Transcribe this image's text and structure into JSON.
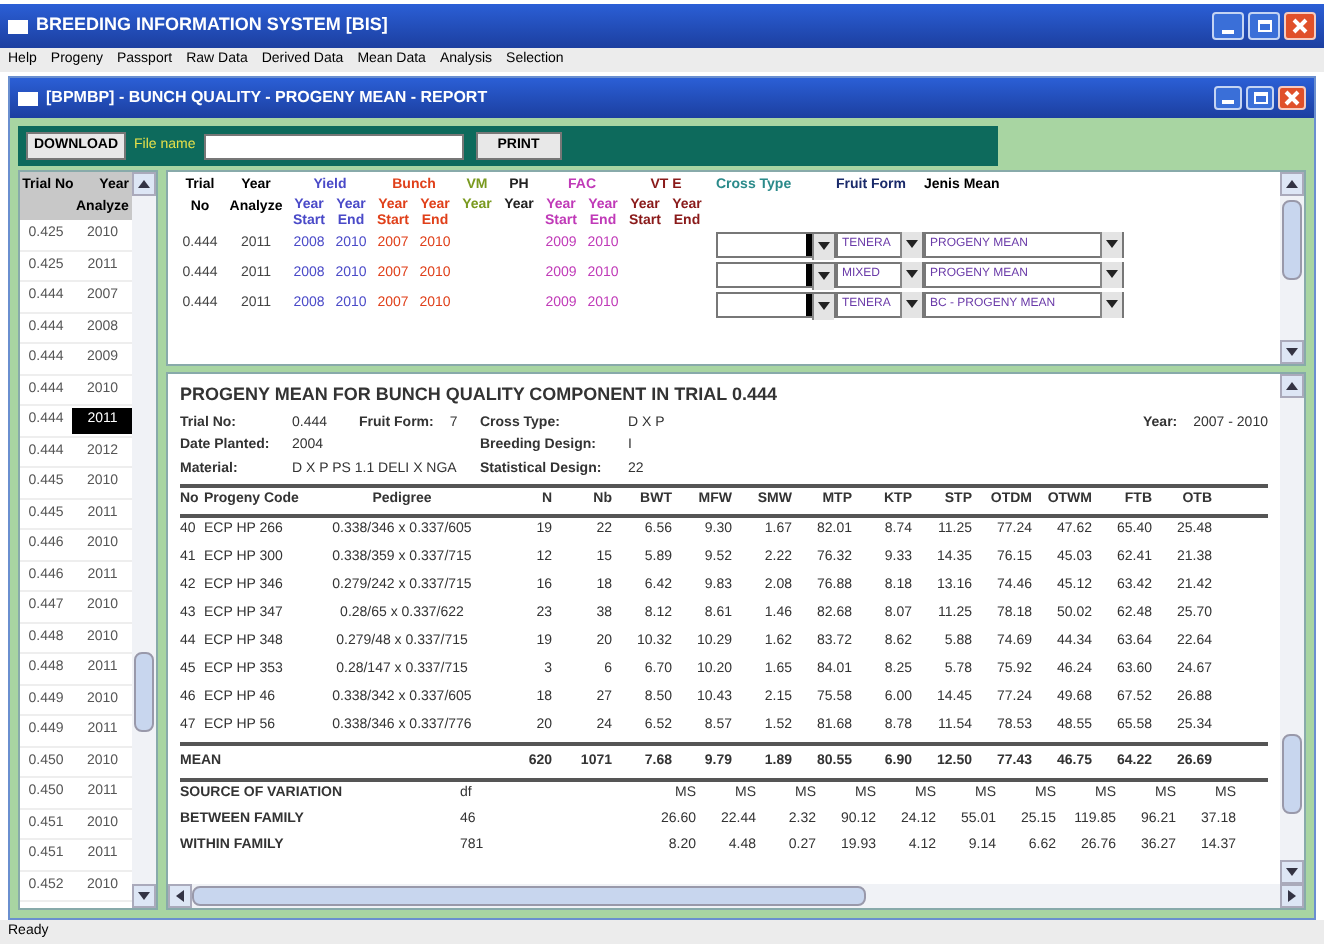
{
  "window": {
    "title": "BREEDING INFORMATION SYSTEM [BIS]"
  },
  "menu": [
    "Help",
    "Progeny",
    "Passport",
    "Raw Data",
    "Derived Data",
    "Mean Data",
    "Analysis",
    "Selection"
  ],
  "child_window": {
    "title": "[BPMBP] - BUNCH QUALITY - PROGENY MEAN - REPORT"
  },
  "toolbar": {
    "download": "DOWNLOAD",
    "file_name_label": "File name",
    "print": "PRINT"
  },
  "trial_list": {
    "columns": [
      "Trial No",
      "Year Analyze"
    ],
    "rows": [
      {
        "trial": "0.425",
        "year": "2010",
        "selected": false
      },
      {
        "trial": "0.425",
        "year": "2011",
        "selected": false
      },
      {
        "trial": "0.444",
        "year": "2007",
        "selected": false
      },
      {
        "trial": "0.444",
        "year": "2008",
        "selected": false
      },
      {
        "trial": "0.444",
        "year": "2009",
        "selected": false
      },
      {
        "trial": "0.444",
        "year": "2010",
        "selected": false
      },
      {
        "trial": "0.444",
        "year": "2011",
        "selected": true
      },
      {
        "trial": "0.444",
        "year": "2012",
        "selected": false
      },
      {
        "trial": "0.445",
        "year": "2010",
        "selected": false
      },
      {
        "trial": "0.445",
        "year": "2011",
        "selected": false
      },
      {
        "trial": "0.446",
        "year": "2010",
        "selected": false
      },
      {
        "trial": "0.446",
        "year": "2011",
        "selected": false
      },
      {
        "trial": "0.447",
        "year": "2010",
        "selected": false
      },
      {
        "trial": "0.448",
        "year": "2010",
        "selected": false
      },
      {
        "trial": "0.448",
        "year": "2011",
        "selected": false
      },
      {
        "trial": "0.449",
        "year": "2010",
        "selected": false
      },
      {
        "trial": "0.449",
        "year": "2011",
        "selected": false
      },
      {
        "trial": "0.450",
        "year": "2010",
        "selected": false
      },
      {
        "trial": "0.450",
        "year": "2011",
        "selected": false
      },
      {
        "trial": "0.451",
        "year": "2010",
        "selected": false
      },
      {
        "trial": "0.451",
        "year": "2011",
        "selected": false
      },
      {
        "trial": "0.452",
        "year": "2010",
        "selected": false
      }
    ]
  },
  "selection_grid": {
    "trial_no": "Trial No",
    "year_analyze": "Year Analyze",
    "groups": [
      {
        "label": "Yield",
        "color": "#4a4ac8",
        "subs": [
          "Year Start",
          "Year End"
        ]
      },
      {
        "label": "Bunch",
        "color": "#e0401a",
        "subs": [
          "Year Start",
          "Year End"
        ]
      },
      {
        "label": "VM",
        "color": "#7a9a20",
        "subs": [
          "Year"
        ]
      },
      {
        "label": "PH",
        "color": "#222222",
        "subs": [
          "Year"
        ]
      },
      {
        "label": "FAC",
        "color": "#c03ab8",
        "subs": [
          "Year Start",
          "Year End"
        ]
      },
      {
        "label": "VT E",
        "color": "#8a1a1a",
        "subs": [
          "Year Start",
          "Year End"
        ]
      }
    ],
    "cross_type": "Cross Type",
    "fruit_form": "Fruit Form",
    "jenis_mean": "Jenis Mean",
    "rows": [
      {
        "trial_no": "0.444",
        "year_analyze": "2011",
        "yield_years": [
          "2008",
          "2010"
        ],
        "bunch_years": [
          "2007",
          "2010"
        ],
        "fac_years": [
          "2009",
          "2010"
        ],
        "fruit_form": "TENERA",
        "jenis_mean": "PROGENY MEAN"
      },
      {
        "trial_no": "0.444",
        "year_analyze": "2011",
        "yield_years": [
          "2008",
          "2010"
        ],
        "bunch_years": [
          "2007",
          "2010"
        ],
        "fac_years": [
          "2009",
          "2010"
        ],
        "fruit_form": "MIXED",
        "jenis_mean": "PROGENY MEAN"
      },
      {
        "trial_no": "0.444",
        "year_analyze": "2011",
        "yield_years": [
          "2008",
          "2010"
        ],
        "bunch_years": [
          "2007",
          "2010"
        ],
        "fac_years": [
          "2009",
          "2010"
        ],
        "fruit_form": "TENERA",
        "jenis_mean": "BC - PROGENY MEAN"
      }
    ]
  },
  "report": {
    "title": "PROGENY MEAN FOR BUNCH QUALITY COMPONENT IN TRIAL  0.444",
    "info": {
      "trial_no": {
        "label": "Trial No:",
        "value": "0.444"
      },
      "fruit_form": {
        "label": "Fruit Form:",
        "value": "7"
      },
      "cross_type": {
        "label": "Cross Type:",
        "value": "D X P"
      },
      "year": {
        "label": "Year:",
        "value": "2007 - 2010"
      },
      "date_planted": {
        "label": "Date Planted:",
        "value": "2004"
      },
      "breeding_design": {
        "label": "Breeding Design:",
        "value": "I"
      },
      "material": {
        "label": "Material:",
        "value": "D X P PS 1.1 DELI X NGA"
      },
      "statistical_design": {
        "label": "Statistical Design:",
        "value": "22"
      }
    },
    "columns": [
      "No",
      "Progeny Code",
      "Pedigree",
      "N",
      "Nb",
      "BWT",
      "MFW",
      "SMW",
      "MTP",
      "KTP",
      "STP",
      "OTDM",
      "OTWM",
      "FTB",
      "OTB"
    ],
    "rows": [
      [
        "40",
        "ECP HP 266",
        "0.338/346 x 0.337/605",
        "19",
        "22",
        "6.56",
        "9.30",
        "1.67",
        "82.01",
        "8.74",
        "11.25",
        "77.24",
        "47.62",
        "65.40",
        "25.48"
      ],
      [
        "41",
        "ECP HP 300",
        "0.338/359 x 0.337/715",
        "12",
        "15",
        "5.89",
        "9.52",
        "2.22",
        "76.32",
        "9.33",
        "14.35",
        "76.15",
        "45.03",
        "62.41",
        "21.38"
      ],
      [
        "42",
        "ECP HP 346",
        "0.279/242 x 0.337/715",
        "16",
        "18",
        "6.42",
        "9.83",
        "2.08",
        "76.88",
        "8.18",
        "13.16",
        "74.46",
        "45.12",
        "63.42",
        "21.42"
      ],
      [
        "43",
        "ECP HP 347",
        "0.28/65 x 0.337/622",
        "23",
        "38",
        "8.12",
        "8.61",
        "1.46",
        "82.68",
        "8.07",
        "11.25",
        "78.18",
        "50.02",
        "62.48",
        "25.70"
      ],
      [
        "44",
        "ECP HP 348",
        "0.279/48 x 0.337/715",
        "19",
        "20",
        "10.32",
        "10.29",
        "1.62",
        "83.72",
        "8.62",
        "5.88",
        "74.69",
        "44.34",
        "63.64",
        "22.64"
      ],
      [
        "45",
        "ECP HP 353",
        "0.28/147 x 0.337/715",
        "3",
        "6",
        "6.70",
        "10.20",
        "1.65",
        "84.01",
        "8.25",
        "5.78",
        "75.92",
        "46.24",
        "63.60",
        "24.67"
      ],
      [
        "46",
        "ECP HP 46",
        "0.338/342 x 0.337/605",
        "18",
        "27",
        "8.50",
        "10.43",
        "2.15",
        "75.58",
        "6.00",
        "14.45",
        "77.24",
        "49.68",
        "67.52",
        "26.88"
      ],
      [
        "47",
        "ECP HP 56",
        "0.338/346 x 0.337/776",
        "20",
        "24",
        "6.52",
        "8.57",
        "1.52",
        "81.68",
        "8.78",
        "11.54",
        "78.53",
        "48.55",
        "65.58",
        "25.34"
      ]
    ],
    "mean": {
      "label": "MEAN",
      "values": [
        "620",
        "1071",
        "7.68",
        "9.79",
        "1.89",
        "80.55",
        "6.90",
        "12.50",
        "77.43",
        "46.75",
        "64.22",
        "26.69"
      ]
    },
    "anova_header": {
      "label": "SOURCE OF VARIATION",
      "df": "df",
      "ms": [
        "MS",
        "MS",
        "MS",
        "MS",
        "MS",
        "MS",
        "MS",
        "MS",
        "MS",
        "MS"
      ]
    },
    "anova": [
      {
        "label": "BETWEEN FAMILY",
        "df": "46",
        "ms": [
          "26.60",
          "22.44",
          "2.32",
          "90.12",
          "24.12",
          "55.01",
          "25.15",
          "119.85",
          "96.21",
          "37.18"
        ]
      },
      {
        "label": "WITHIN FAMILY",
        "df": "781",
        "ms": [
          "8.20",
          "4.48",
          "0.27",
          "19.93",
          "4.12",
          "9.14",
          "6.62",
          "26.76",
          "36.27",
          "14.37"
        ]
      }
    ]
  },
  "status_bar": "Ready"
}
